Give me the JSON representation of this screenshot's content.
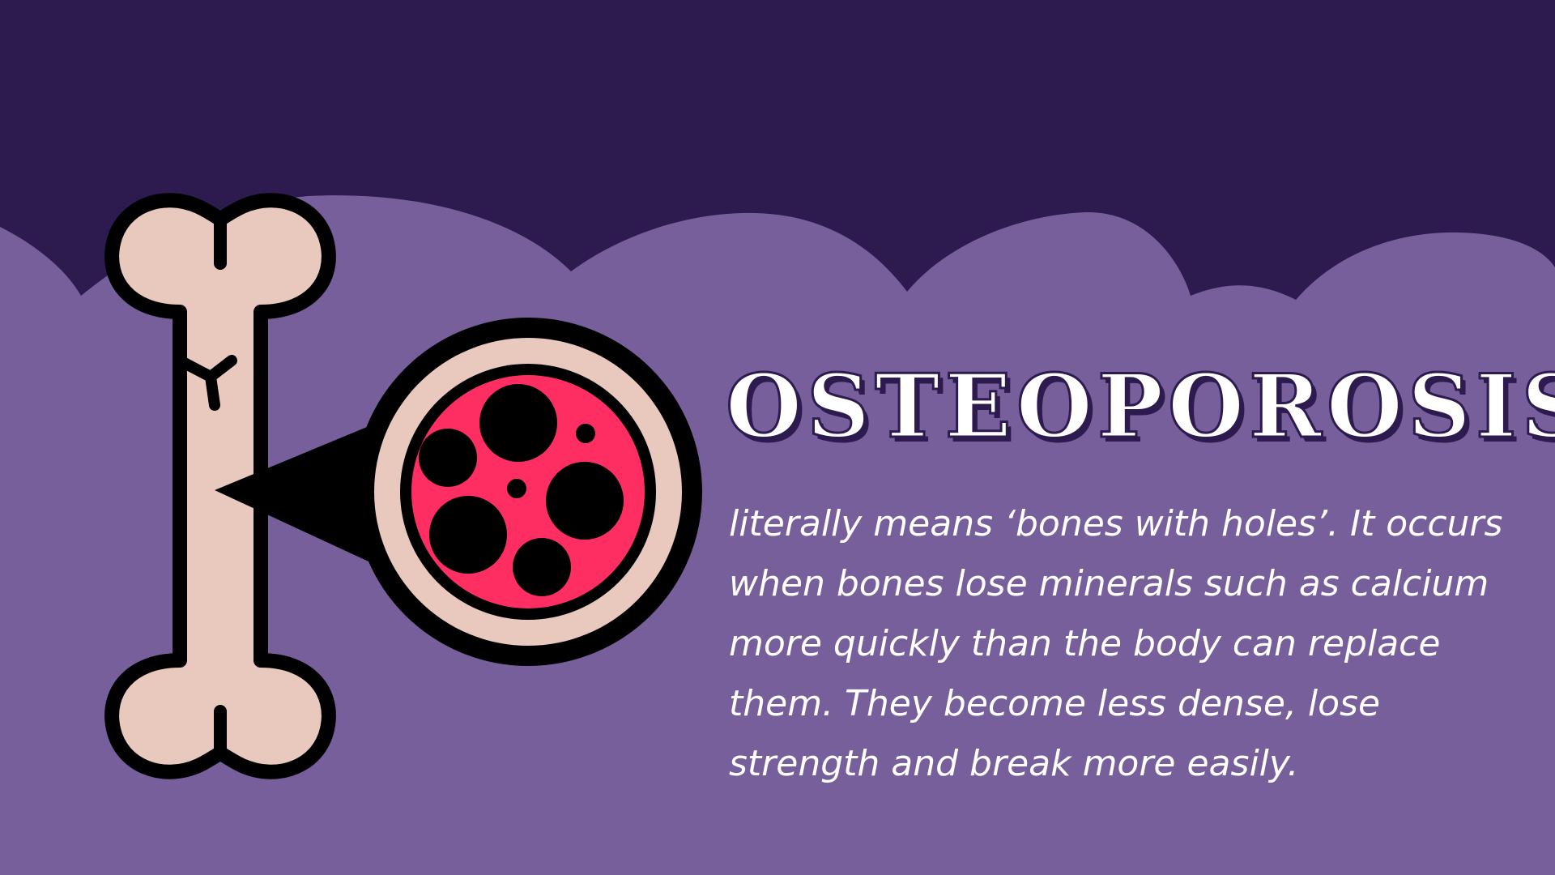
{
  "title": "OSTEOPOROSIS",
  "description": "literally means ‘bones with holes’. It occurs when bones lose minerals such as calcium more quickly than the body can replace them. They become less dense, lose strength and break more easily.",
  "colors": {
    "background_dark": "#2d1a4e",
    "background_cloud": "#775f9b",
    "bone": "#e9c8be",
    "outline": "#000000",
    "marrow": "#ff2e62",
    "text": "#ffffff"
  },
  "icons": [
    "bone-icon",
    "magnifier-icon",
    "porous-bone-cross-section-icon"
  ]
}
